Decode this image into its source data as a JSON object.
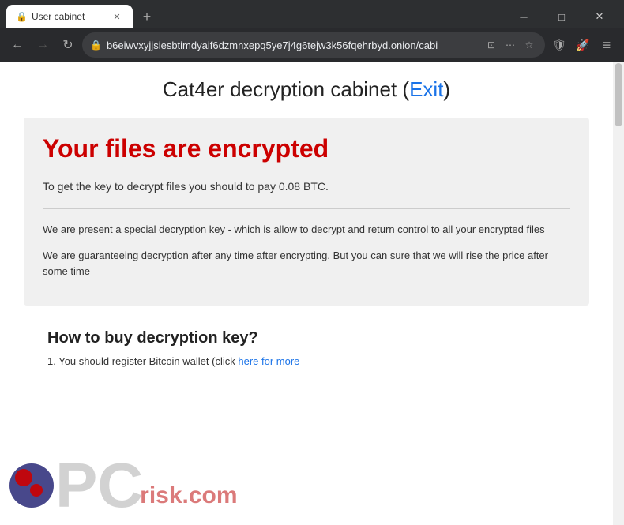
{
  "browser": {
    "tab": {
      "title": "User cabinet",
      "favicon": "🔒"
    },
    "address_bar": {
      "url": "b6eiwvxyjjsiesbtimdyaif6dzmnxepq5ye7j4g6tejw3k56fqehrbyd.onion/cabi",
      "secure_icon": "🔒"
    },
    "window_controls": {
      "minimize": "─",
      "maximize": "□",
      "close": "✕"
    }
  },
  "page": {
    "title_prefix": "Cat4er decryption cabinet (",
    "title_exit": "Exit",
    "title_suffix": ")",
    "headline": "Your files are encrypted",
    "decrypt_instruction": "To get the key to decrypt files you should to pay 0.08 BTC.",
    "description_1": "We are present a special decryption key - which is allow to decrypt and return control to all your encrypted files",
    "description_2": "We are guaranteeing decryption after any time after encrypting. But you can sure that we will rise the price after some time",
    "how_to_title": "How to buy decryption key?",
    "how_to_step_1_prefix": "1. You should register Bitcoin wallet (click ",
    "how_to_step_1_link": "here for more",
    "how_to_step_1_suffix": ""
  },
  "icons": {
    "back": "←",
    "forward": "→",
    "refresh": "↻",
    "new_tab": "+",
    "bookmark": "☆",
    "shield": "🛡",
    "rocket": "🚀",
    "menu": "⋯",
    "extensions": "⊞"
  }
}
